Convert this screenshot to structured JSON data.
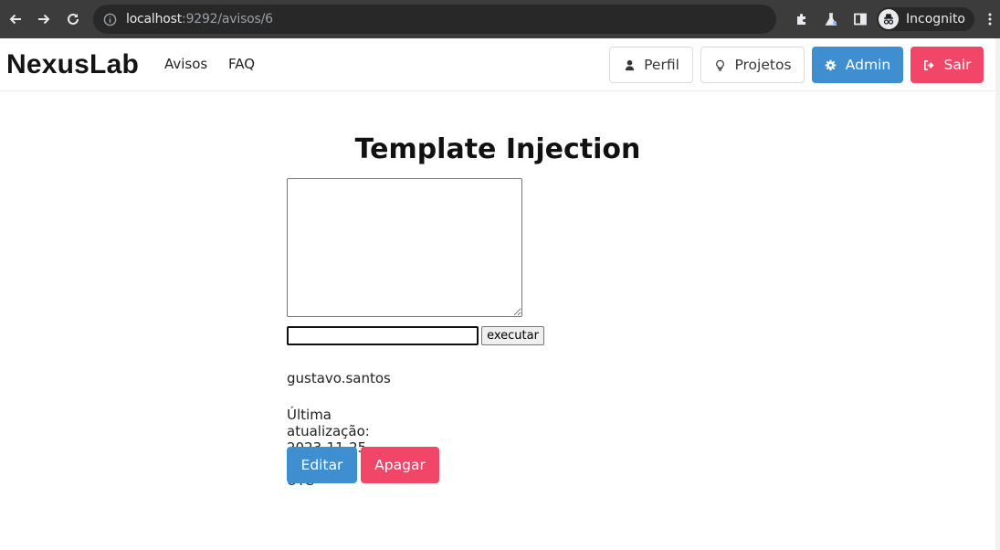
{
  "browser": {
    "url_host": "localhost",
    "url_rest": ":9292/avisos/6",
    "profile_label": "Incognito"
  },
  "navbar": {
    "brand": "NexusLab",
    "links": [
      "Avisos",
      "FAQ"
    ],
    "buttons": {
      "perfil": "Perfil",
      "projetos": "Projetos",
      "admin": "Admin",
      "sair": "Sair"
    }
  },
  "main": {
    "title": "Template Injection",
    "textarea_value": "",
    "command_value": "",
    "execute_label": "executar",
    "author": "gustavo.santos",
    "updated": "Última atualização: 2023-11-25 19:41:56 UTC",
    "edit_label": "Editar",
    "delete_label": "Apagar"
  },
  "colors": {
    "primary": "#3e8ed0",
    "danger": "#f14668",
    "chrome": "#3c3c3c"
  }
}
